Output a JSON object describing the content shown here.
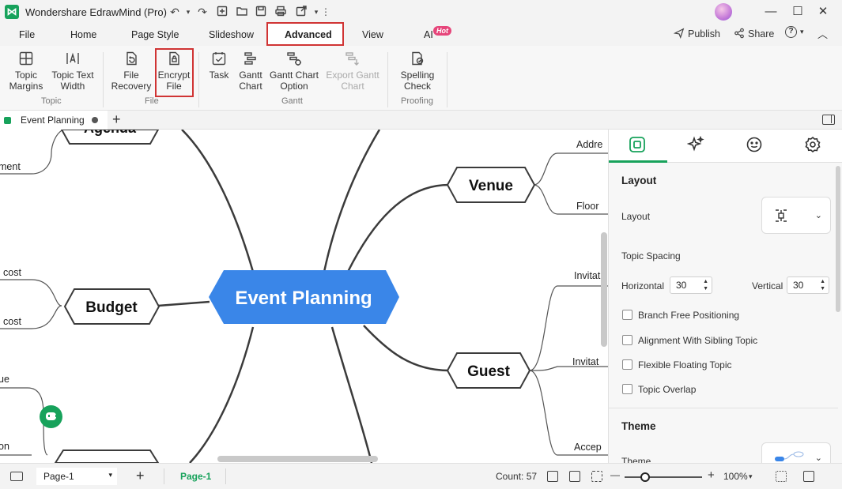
{
  "app": {
    "title": "Wondershare EdrawMind (Pro)",
    "logo": "edrawmind-logo"
  },
  "quick_access": [
    "undo-icon",
    "redo-icon",
    "new-icon",
    "open-icon",
    "save-icon",
    "print-icon",
    "export-icon",
    "more-icon"
  ],
  "window_controls": {
    "minimize": "—",
    "maximize": "☐",
    "close": "✕"
  },
  "menu": {
    "file": "File",
    "home": "Home",
    "page_style": "Page Style",
    "slideshow": "Slideshow",
    "advanced": "Advanced",
    "view": "View",
    "ai": "AI",
    "ai_badge": "Hot",
    "publish": "Publish",
    "share": "Share",
    "help": "?",
    "help_caret": "▾",
    "collapse": "︿"
  },
  "ribbon": {
    "topic_margins": "Topic\nMargins",
    "topic_text_width": "Topic Text\nWidth",
    "group_topic": "Topic",
    "file_recovery": "File\nRecovery",
    "encrypt_file": "Encrypt\nFile",
    "group_file": "File",
    "task": "Task",
    "gantt_chart": "Gantt\nChart",
    "gantt_chart_option": "Gantt Chart\nOption",
    "export_gantt_chart": "Export Gantt\nChart",
    "group_gantt": "Gantt",
    "spelling_check": "Spelling\nCheck",
    "group_proofing": "Proofing"
  },
  "doc_tab": {
    "label": "Event Planning",
    "add": "+"
  },
  "mindmap": {
    "central": "Event Planning",
    "topics": {
      "agenda": "Agenda",
      "venue": "Venue",
      "budget": "Budget",
      "guest": "Guest"
    },
    "subtopics": {
      "ment": "ment",
      "addre": "Addre",
      "floor": "Floor",
      "cost1": "cost",
      "cost2": "cost",
      "invitat1": "Invitat",
      "invitat2": "Invitat",
      "accep": "Accep",
      "ue": "ue",
      "on": "on"
    },
    "colors": {
      "central": "#3a86e8",
      "line": "#3b3b3b"
    }
  },
  "panel": {
    "tabs": [
      "layout-icon",
      "ai-sparkle-icon",
      "emoji-icon",
      "badge-icon"
    ],
    "layout_title": "Layout",
    "layout_label": "Layout",
    "topic_spacing": "Topic Spacing",
    "horizontal_label": "Horizontal",
    "horizontal_value": "30",
    "vertical_label": "Vertical",
    "vertical_value": "30",
    "checkboxes": [
      "Branch Free Positioning",
      "Alignment With Sibling Topic",
      "Flexible Floating Topic",
      "Topic Overlap"
    ],
    "theme_title": "Theme",
    "theme_label": "Theme"
  },
  "status": {
    "page_select": "Page-1",
    "add_page": "+",
    "active_page": "Page-1",
    "count": "Count: 57",
    "zoom_minus": "—",
    "zoom_plus": "+",
    "zoom": "100%",
    "zoom_caret": "▾"
  },
  "accent_color": "#17a25b"
}
